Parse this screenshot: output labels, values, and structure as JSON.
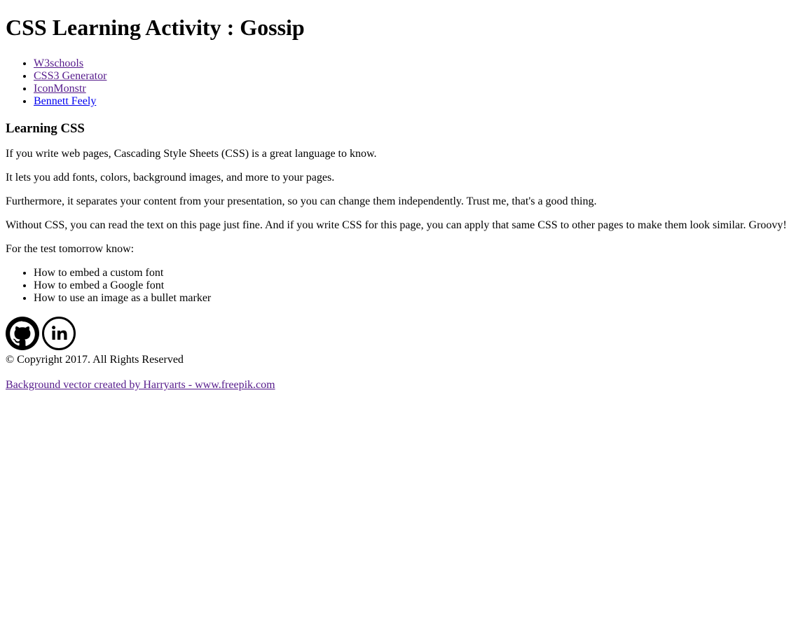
{
  "page": {
    "title": "CSS Learning Activity : Gossip"
  },
  "nav": {
    "links": [
      {
        "label": "W3schools",
        "state": "visited"
      },
      {
        "label": "CSS3 Generator",
        "state": "visited"
      },
      {
        "label": "IconMonstr",
        "state": "visited"
      },
      {
        "label": "Bennett Feely",
        "state": "unvisited"
      }
    ]
  },
  "article": {
    "heading": "Learning CSS",
    "paragraphs": [
      "If you write web pages, Cascading Style Sheets (CSS) is a great language to know.",
      "It lets you add fonts, colors, background images, and more to your pages.",
      "Furthermore, it separates your content from your presentation, so you can change them independently. Trust me, that's a good thing.",
      "Without CSS, you can read the text on this page just fine. And if you write CSS for this page, you can apply that same CSS to other pages to make them look similar. Groovy!",
      "For the test tomorrow know:"
    ],
    "test_items": [
      "How to embed a custom font",
      "How to embed a Google font",
      "How to use an image as a bullet marker"
    ]
  },
  "footer": {
    "social": [
      {
        "icon": "github-icon"
      },
      {
        "icon": "linkedin-icon"
      }
    ],
    "copyright": "© Copyright 2017. All Rights Reserved",
    "credit_link": "Background vector created by Harryarts - www.freepik.com"
  },
  "colors": {
    "text": "#000000",
    "link_visited": "#551a8b",
    "link_unvisited": "#0000ee",
    "background": "#ffffff"
  }
}
